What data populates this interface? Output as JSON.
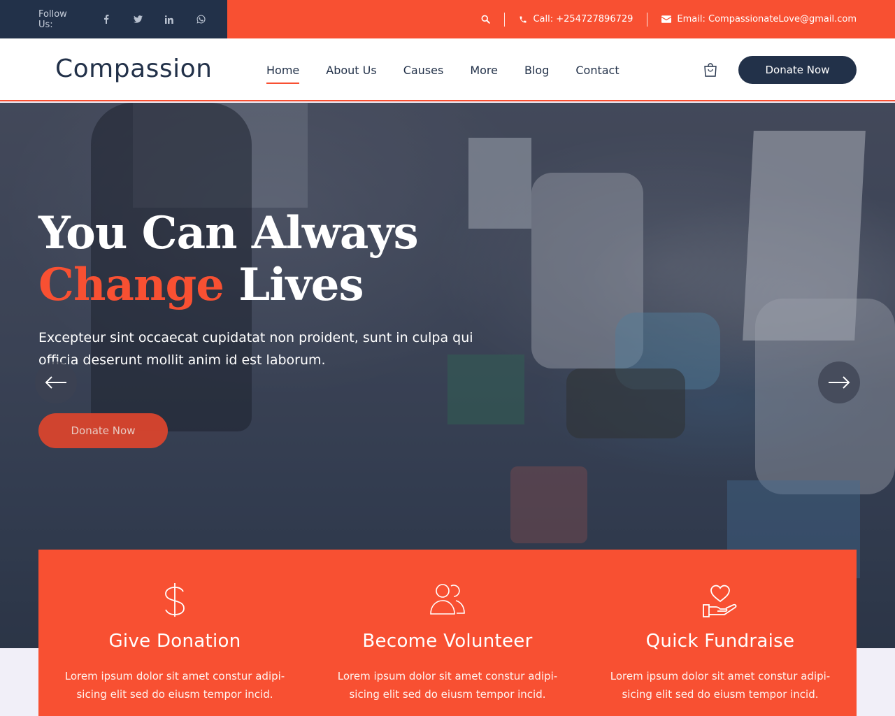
{
  "topbar": {
    "follow_label": "Follow Us:",
    "social": [
      "f",
      "twitter",
      "in",
      "whatsapp"
    ],
    "phone": "Call: +254727896729",
    "email": "Email: CompassionateLove@gmail.com"
  },
  "header": {
    "logo": "Compassion",
    "nav": [
      {
        "label": "Home",
        "active": true
      },
      {
        "label": "About Us",
        "active": false
      },
      {
        "label": "Causes",
        "active": false
      },
      {
        "label": "More",
        "active": false
      },
      {
        "label": "Blog",
        "active": false
      },
      {
        "label": "Contact",
        "active": false
      }
    ],
    "donate_label": "Donate Now"
  },
  "hero": {
    "title_line1": "You Can Always",
    "title_accent": "Change",
    "title_rest": " Lives",
    "text": "Excepteur sint occaecat cupidatat non proident, sunt in culpa qui officia deserunt mollit anim id est laborum.",
    "button": "Donate Now"
  },
  "features": [
    {
      "icon": "dollar-icon",
      "title": "Give Donation",
      "desc": "Lorem ipsum dolor sit amet constur adipi-sicing elit sed do eiusm tempor incid."
    },
    {
      "icon": "users-icon",
      "title": "Become Volunteer",
      "desc": "Lorem ipsum dolor sit amet constur adipi-sicing elit sed do eiusm tempor incid."
    },
    {
      "icon": "heart-hand-icon",
      "title": "Quick Fundraise",
      "desc": "Lorem ipsum dolor sit amet constur adipi-sicing elit sed do eiusm tempor incid."
    }
  ],
  "colors": {
    "accent": "#f85032",
    "navy": "#223149"
  }
}
